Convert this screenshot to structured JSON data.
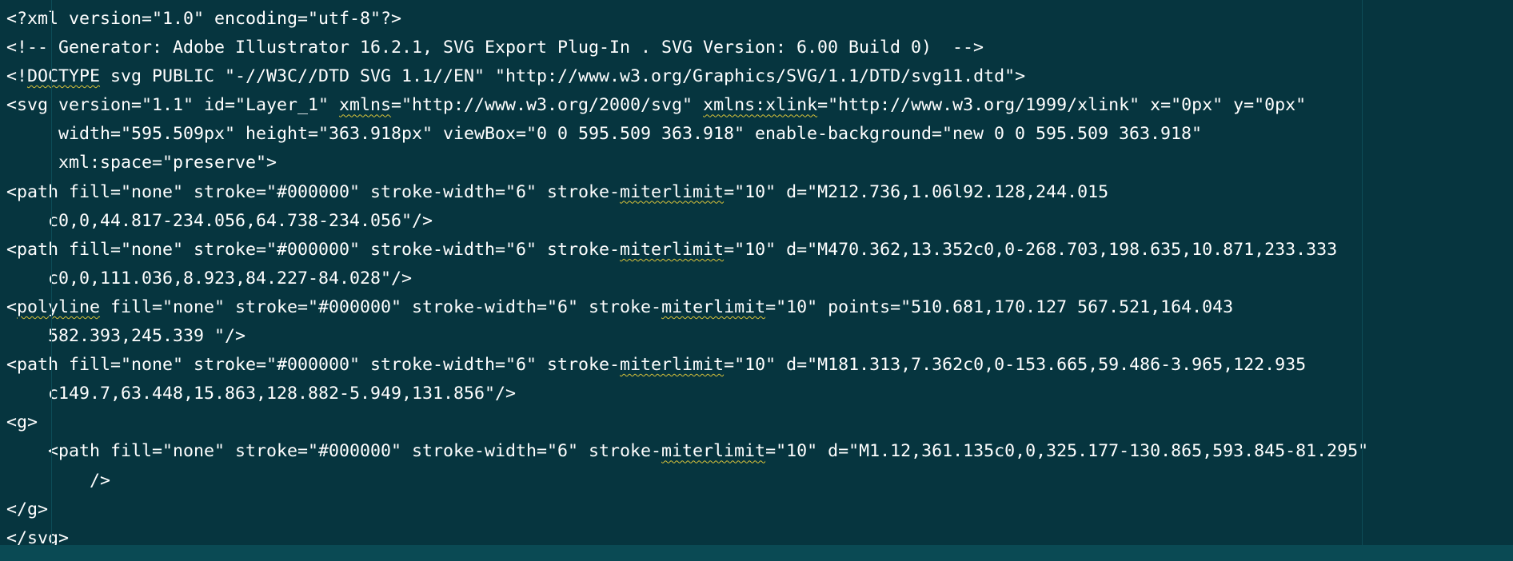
{
  "editor": {
    "colors": {
      "background": "#06353f",
      "text": "#ffffff",
      "spellcheck_underline": "#d8c23a"
    },
    "lines": [
      "<?xml version=\"1.0\" encoding=\"utf-8\"?>",
      "<!-- Generator: Adobe Illustrator 16.2.1, SVG Export Plug-In . SVG Version: 6.00 Build 0)  -->",
      "<!DOCTYPE svg PUBLIC \"-//W3C//DTD SVG 1.1//EN\" \"http://www.w3.org/Graphics/SVG/1.1/DTD/svg11.dtd\">",
      "<svg version=\"1.1\" id=\"Layer_1\" xmlns=\"http://www.w3.org/2000/svg\" xmlns:xlink=\"http://www.w3.org/1999/xlink\" x=\"0px\" y=\"0px\"",
      "\t width=\"595.509px\" height=\"363.918px\" viewBox=\"0 0 595.509 363.918\" enable-background=\"new 0 0 595.509 363.918\"",
      "\t xml:space=\"preserve\">",
      "<path fill=\"none\" stroke=\"#000000\" stroke-width=\"6\" stroke-miterlimit=\"10\" d=\"M212.736,1.06l92.128,244.015",
      "\tc0,0,44.817-234.056,64.738-234.056\"/>",
      "<path fill=\"none\" stroke=\"#000000\" stroke-width=\"6\" stroke-miterlimit=\"10\" d=\"M470.362,13.352c0,0-268.703,198.635,10.871,233.333",
      "\tc0,0,111.036,8.923,84.227-84.028\"/>",
      "<polyline fill=\"none\" stroke=\"#000000\" stroke-width=\"6\" stroke-miterlimit=\"10\" points=\"510.681,170.127 567.521,164.043",
      "\t582.393,245.339 \"/>",
      "<path fill=\"none\" stroke=\"#000000\" stroke-width=\"6\" stroke-miterlimit=\"10\" d=\"M181.313,7.362c0,0-153.665,59.486-3.965,122.935",
      "\tc149.7,63.448,15.863,128.882-5.949,131.856\"/>",
      "<g>",
      "\t<path fill=\"none\" stroke=\"#000000\" stroke-width=\"6\" stroke-miterlimit=\"10\" d=\"M1.12,361.135c0,0,325.177-130.865,593.845-81.295\"",
      "\t\t/>",
      "</g>",
      "</svg>"
    ],
    "spellcheck_words": [
      "DOCTYPE",
      "xmlns",
      "xmlns:xlink",
      "miterlimit",
      "polyline"
    ]
  }
}
